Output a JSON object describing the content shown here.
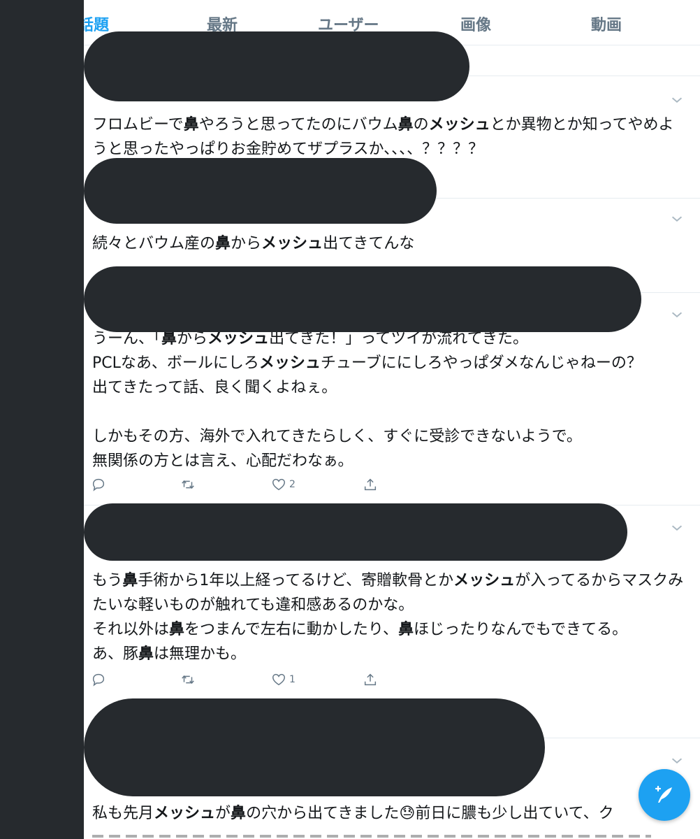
{
  "tabs": [
    {
      "label": "話題",
      "active": true
    },
    {
      "label": "最新",
      "active": false
    },
    {
      "label": "ユーザー",
      "active": false
    },
    {
      "label": "画像",
      "active": false
    },
    {
      "label": "動画",
      "active": false
    }
  ],
  "tweets": [
    {
      "segments": [
        {
          "text": "フロムビーで",
          "bold": false
        },
        {
          "text": "鼻",
          "bold": true
        },
        {
          "text": "やろうと思ってたのにバウム",
          "bold": false
        },
        {
          "text": "鼻",
          "bold": true
        },
        {
          "text": "の",
          "bold": false
        },
        {
          "text": "メッシュ",
          "bold": true
        },
        {
          "text": "とか異物とか知ってやめようと思ったやっぱりお金貯めてザプラスか、、、、？？？？",
          "bold": false
        }
      ]
    },
    {
      "segments": [
        {
          "text": "続々とバウム産の",
          "bold": false
        },
        {
          "text": "鼻",
          "bold": true
        },
        {
          "text": "から",
          "bold": false
        },
        {
          "text": "メッシュ",
          "bold": true
        },
        {
          "text": "出てきてんな",
          "bold": false
        }
      ]
    },
    {
      "segments": [
        {
          "text": "うーん、「",
          "bold": false
        },
        {
          "text": "鼻",
          "bold": true
        },
        {
          "text": "から",
          "bold": false
        },
        {
          "text": "メッシュ",
          "bold": true
        },
        {
          "text": "出てきた！」ってツイが流れてきた。\nPCLなあ、ボールにしろ",
          "bold": false
        },
        {
          "text": "メッシュ",
          "bold": true
        },
        {
          "text": "チューブににしろやっぱダメなんじゃねーの？\n出てきたって話、良く聞くよねぇ。\n\nしかもその方、海外で入れてきたらしく、すぐに受診できないようで。\n無関係の方とは言え、心配だわなぁ。",
          "bold": false
        }
      ],
      "likes": "2"
    },
    {
      "segments": [
        {
          "text": "もう",
          "bold": false
        },
        {
          "text": "鼻",
          "bold": true
        },
        {
          "text": "手術から1年以上経ってるけど、寄贈軟骨とか",
          "bold": false
        },
        {
          "text": "メッシュ",
          "bold": true
        },
        {
          "text": "が入ってるからマスクみたいな軽いものが触れても違和感あるのかな。\nそれ以外は",
          "bold": false
        },
        {
          "text": "鼻",
          "bold": true
        },
        {
          "text": "をつまんで左右に動かしたり、",
          "bold": false
        },
        {
          "text": "鼻",
          "bold": true
        },
        {
          "text": "ほじったりなんでもできてる。\nあ、豚",
          "bold": false
        },
        {
          "text": "鼻",
          "bold": true
        },
        {
          "text": "は無理かも。",
          "bold": false
        }
      ],
      "likes": "1"
    },
    {
      "segments": [
        {
          "text": "私も先月",
          "bold": false
        },
        {
          "text": "メッシュ",
          "bold": true
        },
        {
          "text": "が",
          "bold": false
        },
        {
          "text": "鼻",
          "bold": true
        },
        {
          "text": "の穴から出てきました😓前日に膿も少し出ていて、ク",
          "bold": false
        }
      ]
    }
  ],
  "colors": {
    "accent": "#1da1f2",
    "redaction": "#262a2e",
    "muted": "#657786",
    "text": "#14171a"
  },
  "icons": {
    "reply": "reply-icon",
    "retweet": "retweet-icon",
    "like": "heart-icon",
    "share": "share-icon",
    "more": "chevron-down-icon",
    "compose": "compose-tweet-icon"
  }
}
